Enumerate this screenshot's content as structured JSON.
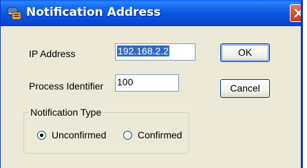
{
  "window": {
    "title": "Notification Address"
  },
  "form": {
    "ip_address": {
      "label": "IP Address",
      "value": "192.168.2.2"
    },
    "process_identifier": {
      "label": "Process Identifier",
      "value": "100"
    },
    "notification_type": {
      "legend": "Notification Type",
      "options": [
        "Unconfirmed",
        "Confirmed"
      ],
      "selected": "Unconfirmed"
    }
  },
  "buttons": {
    "ok_label": "OK",
    "cancel_label": "Cancel"
  },
  "colors": {
    "titlebar": "#0a55e0",
    "dialog_background": "#ece9d8",
    "selection_highlight": "#316ac5",
    "close_button": "#d6502c"
  },
  "icons": {
    "app": "app-icon",
    "close": "close-icon"
  }
}
